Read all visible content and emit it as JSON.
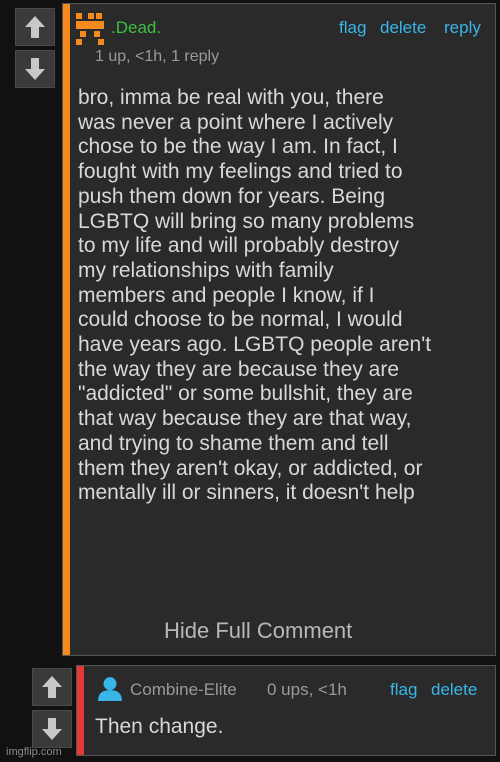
{
  "comment1": {
    "username": ".Dead.",
    "meta": "1 up, <1h, 1 reply",
    "actions": {
      "flag": "flag",
      "delete": "delete",
      "reply": "reply"
    },
    "body": "bro, imma be real with you, there\nwas never a point where I actively\nchose to be the way I am. In fact, I\nfought with my feelings and tried to\npush them down for years. Being\nLGBTQ will bring so many problems\nto my life and will probably destroy\nmy relationships with family\nmembers and people I know, if I\ncould choose to be normal, I would\nhave years ago. LGBTQ people aren't\nthe way they are because they are\n\"addicted\" or some bullshit, they are\nthat way because they are that way,\nand trying to shame them and tell\nthem they aren't okay, or addicted, or\nmentally ill or sinners, it doesn't help",
    "hide_full": "Hide Full Comment",
    "stripe_color": "#f58a1f",
    "username_color": "#3fbf3f"
  },
  "comment2": {
    "username": "Combine-Elite",
    "meta": "0 ups, <1h",
    "actions": {
      "flag": "flag",
      "delete": "delete"
    },
    "body": "Then change.",
    "stripe_color": "#e53935",
    "avatar_color": "#38b6e8"
  },
  "icons": {
    "upvote": "up-arrow-icon",
    "downvote": "down-arrow-icon",
    "avatar2": "user-silhouette-icon"
  },
  "watermark": "imgflip.com"
}
